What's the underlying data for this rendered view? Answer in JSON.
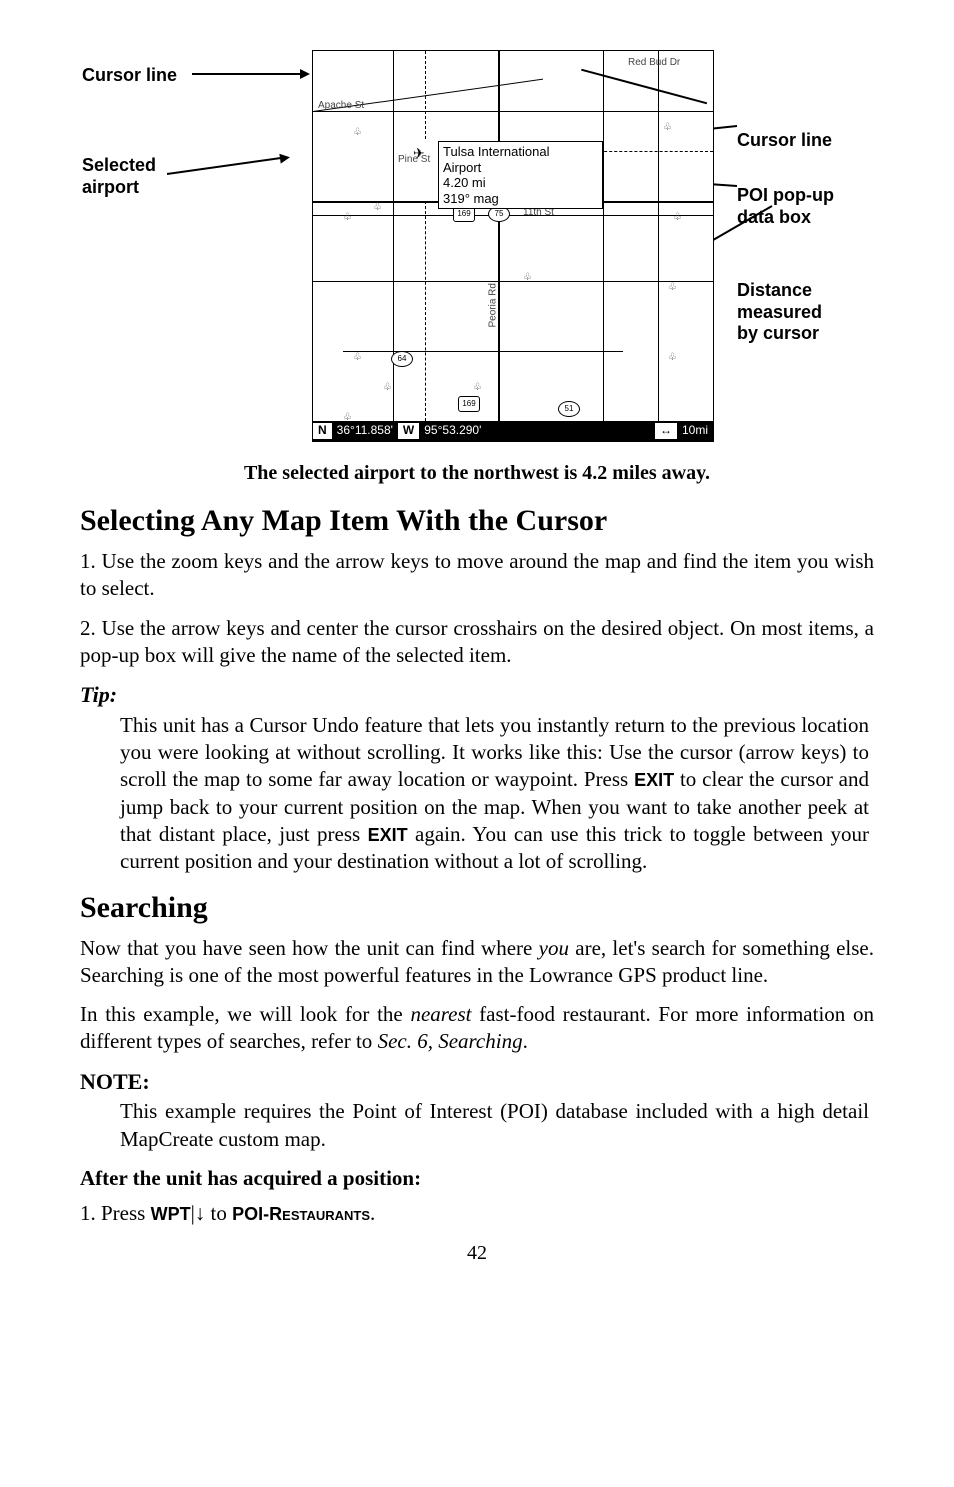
{
  "figure": {
    "labels": {
      "cursor_line_left": "Cursor line",
      "selected_airport": "Selected\nairport",
      "cursor_line_right": "Cursor line",
      "poi_popup": "POI pop-up\ndata box",
      "distance": "Distance\nmeasured\nby cursor"
    },
    "popup": {
      "line1": "Tulsa International",
      "line2": "Airport",
      "line3": "4.20 mi",
      "line4": "319° mag"
    },
    "status": {
      "n": "N",
      "lat": "36°11.858'",
      "w": "W",
      "lon": "95°53.290'",
      "arrow": "↔",
      "scale": "10mi"
    },
    "map": {
      "street1": "Apache St",
      "street2": "Pine St",
      "street3": "11th St",
      "street4": "Red Bud Dr",
      "street5": "Peoria Rd",
      "shield1": "169",
      "shield2": "75",
      "shield3": "169",
      "shield4": "64",
      "shield5": "51",
      "plane": "✈"
    },
    "caption": "The selected airport to the northwest is 4.2 miles away."
  },
  "h_selecting": "Selecting Any Map Item With the Cursor",
  "p_sel_1": "1. Use the zoom keys and the arrow keys to move around the map and find the item you wish to select.",
  "p_sel_2": "2. Use the arrow keys and center the cursor crosshairs on the desired object. On most items, a pop-up box will give the name of the selected item.",
  "tip_label": "Tip:",
  "tip_body_a": "This unit has a Cursor Undo feature that lets you instantly return to the previous location you were looking at without scrolling. It works like this: Use the cursor (arrow keys) to scroll the map to some far away location or waypoint. Press ",
  "tip_exit1": "EXIT",
  "tip_body_b": " to clear the cursor and jump back to your current position on the map. When you want to take another peek at that distant place, just press ",
  "tip_exit2": "EXIT",
  "tip_body_c": " again. You can use this trick to toggle between your current position and your destination without a lot of scrolling.",
  "h_searching": "Searching",
  "p_search_1a": "Now that you have seen how the unit can find where ",
  "p_search_1_you": "you",
  "p_search_1b": " are, let's search for something else. Searching is one of the most powerful features in the Lowrance GPS product line.",
  "p_search_2a": "In this example, we will look for the ",
  "p_search_2_nearest": "nearest",
  "p_search_2b": " fast-food restaurant. For more information on different types of searches, refer to ",
  "p_search_2_sec": "Sec. 6, Searching",
  "p_search_2c": ".",
  "note_label": "NOTE:",
  "note_body": "This example requires the Point of Interest (POI) database included with a high detail MapCreate  custom map.",
  "after_pos": "After the unit has acquired a position",
  "step1_a": "1. Press ",
  "step1_wpt": "WPT",
  "step1_b": "|↓ to ",
  "step1_poi": "POI-Restaurants",
  "step1_c": ".",
  "page": "42"
}
